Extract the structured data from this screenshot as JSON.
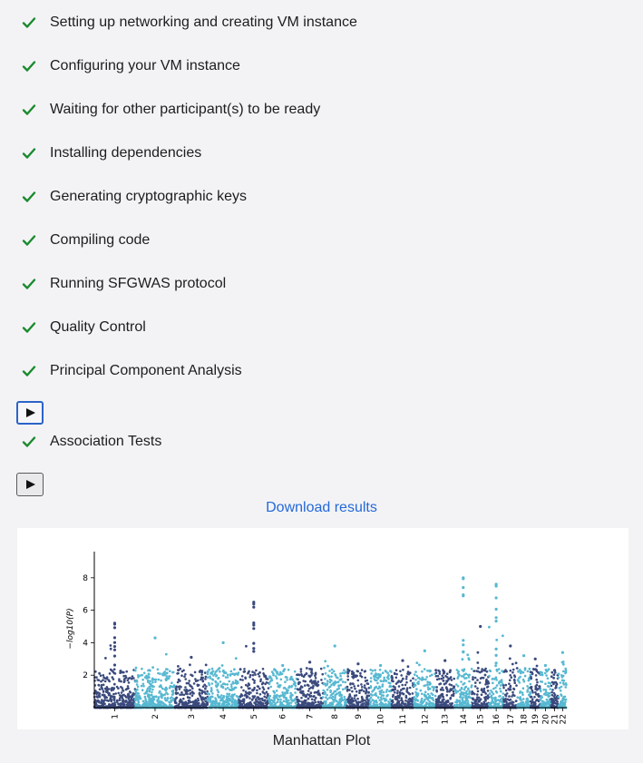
{
  "steps": [
    {
      "label": "Setting up networking and creating VM instance",
      "status": "done"
    },
    {
      "label": "Configuring your VM instance",
      "status": "done"
    },
    {
      "label": "Waiting for other participant(s) to be ready",
      "status": "done"
    },
    {
      "label": "Installing dependencies",
      "status": "done"
    },
    {
      "label": "Generating cryptographic keys",
      "status": "done"
    },
    {
      "label": "Compiling code",
      "status": "done"
    },
    {
      "label": "Running SFGWAS protocol",
      "status": "done"
    },
    {
      "label": "Quality Control",
      "status": "done"
    },
    {
      "label": "Principal Component Analysis",
      "status": "done"
    },
    {
      "label": "Association Tests",
      "status": "done"
    }
  ],
  "play_buttons": [
    {
      "icon": "play-icon",
      "glyph": "▶"
    },
    {
      "icon": "play-icon",
      "glyph": "▶"
    }
  ],
  "download": {
    "label": "Download results"
  },
  "plot": {
    "caption": "Manhattan Plot"
  },
  "colors": {
    "check": "#1a8a2e",
    "link": "#2469d9",
    "series_dark": "#3b4a7d",
    "series_light": "#57b8d1"
  },
  "chart_data": {
    "type": "scatter",
    "title": "",
    "xlabel": "",
    "ylabel": "−log10(P)",
    "yticks": [
      "2",
      "4",
      "6",
      "8"
    ],
    "ylim": [
      0,
      9.5
    ],
    "categories": [
      "1",
      "2",
      "3",
      "4",
      "5",
      "6",
      "7",
      "8",
      "9",
      "10",
      "11",
      "12",
      "13",
      "14",
      "15",
      "16",
      "17",
      "18",
      "19",
      "20",
      "21",
      "22"
    ],
    "series": [
      {
        "values": [
          5.2,
          4.3,
          3.1,
          4.0,
          6.5,
          2.6,
          2.8,
          3.8,
          2.7,
          2.6,
          2.9,
          3.5,
          2.9,
          8.0,
          5.0,
          7.6,
          3.8,
          3.2,
          3.0,
          2.6,
          2.3,
          3.4
        ]
      }
    ],
    "grid": false,
    "legend": "none"
  }
}
